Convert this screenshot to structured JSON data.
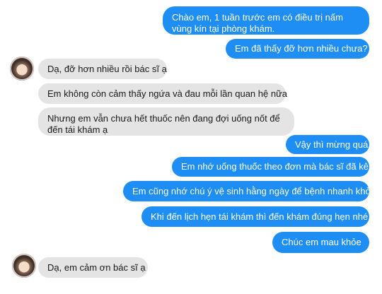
{
  "conversation": {
    "messages": [
      {
        "sender": "doctor",
        "text": "Chào em, 1 tuần trước em có điều trị nấm vùng kín tại phòng khám."
      },
      {
        "sender": "doctor",
        "text": "Em đã thấy đỡ hơn nhiều chưa?"
      },
      {
        "sender": "patient",
        "text": "Dạ, đỡ hơn nhiều rồi bác sĩ ạ"
      },
      {
        "sender": "patient",
        "text": "Em không còn cảm thấy ngứa và đau mỗi lần quan hệ nữa"
      },
      {
        "sender": "patient",
        "text": "Nhưng em vẫn chưa hết thuốc nên đang đợi uống nốt để đến tái khám ạ"
      },
      {
        "sender": "doctor",
        "text": "Vậy thì mừng quá"
      },
      {
        "sender": "doctor",
        "text": "Em nhớ uống thuốc theo đơn mà bác sĩ đã kê"
      },
      {
        "sender": "doctor",
        "text": "Em cũng nhớ chú ý vệ sinh hằng ngày để bệnh nhanh khỏi"
      },
      {
        "sender": "doctor",
        "text": "Khi đến lịch hẹn tái khám thì đến khám đúng hẹn nhé"
      },
      {
        "sender": "doctor",
        "text": "Chúc em mau khỏe"
      },
      {
        "sender": "patient",
        "text": "Dạ, em cảm ơn bác sĩ ạ"
      }
    ]
  },
  "colors": {
    "outgoing_bubble": "#1e8ef5",
    "incoming_bubble": "#e4e4e4"
  }
}
